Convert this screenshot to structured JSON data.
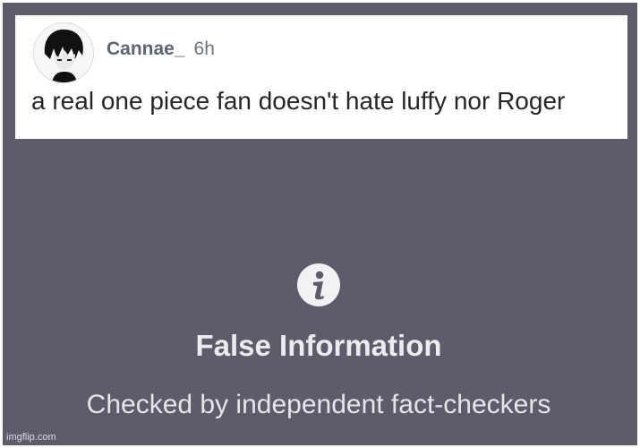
{
  "post": {
    "username": "Cannae_",
    "timestamp": "6h",
    "text": "a real one piece fan doesn't hate luffy nor Roger"
  },
  "warning": {
    "icon": "info-icon",
    "title": "False Information",
    "subtitle": "Checked by independent fact-checkers"
  },
  "watermark": "imgflip.com",
  "colors": {
    "overlay_background": "#5e5b6b",
    "post_background": "#ffffff",
    "username": "#5c6570"
  }
}
